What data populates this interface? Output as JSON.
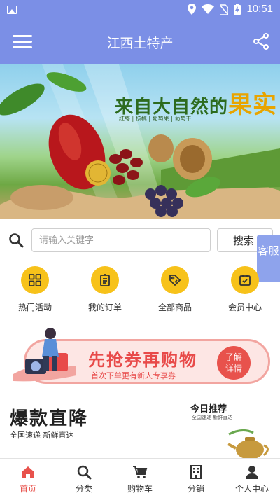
{
  "status_bar": {
    "time": "10:51"
  },
  "app_bar": {
    "title": "江西土特产"
  },
  "banner": {
    "headline_prefix": "来自大自然的",
    "headline_emphasis": "果实",
    "tags": "红枣 | 核桃 | 葡萄果 | 葡萄干"
  },
  "search": {
    "placeholder": "请输入关键字",
    "button_label": "搜索"
  },
  "service_tab": {
    "label": "客服"
  },
  "quick_menu": [
    {
      "label": "热门活动",
      "icon": "grid-icon"
    },
    {
      "label": "我的订单",
      "icon": "order-list-icon"
    },
    {
      "label": "全部商品",
      "icon": "tag-icon"
    },
    {
      "label": "会员中心",
      "icon": "calendar-icon"
    }
  ],
  "coupon_banner": {
    "title": "先抢券再购物",
    "subtitle": "首次下单更有新人专享券",
    "button_line1": "了解",
    "button_line2": "详情"
  },
  "promo": {
    "title": "爆款直降",
    "subtitle": "全国速递  新鲜直达",
    "daily_title": "今日推荐",
    "daily_subtitle": "全国速递  新鲜直达"
  },
  "tab_bar": [
    {
      "label": "首页",
      "icon": "home-icon",
      "active": true
    },
    {
      "label": "分类",
      "icon": "search-icon",
      "active": false
    },
    {
      "label": "购物车",
      "icon": "cart-icon",
      "active": false
    },
    {
      "label": "分销",
      "icon": "building-icon",
      "active": false
    },
    {
      "label": "个人中心",
      "icon": "person-icon",
      "active": false
    }
  ],
  "colors": {
    "primary": "#7b8fe6",
    "accent_yellow": "#f7c21a",
    "coupon_red": "#e84a49",
    "active_tab": "#e8524c"
  }
}
